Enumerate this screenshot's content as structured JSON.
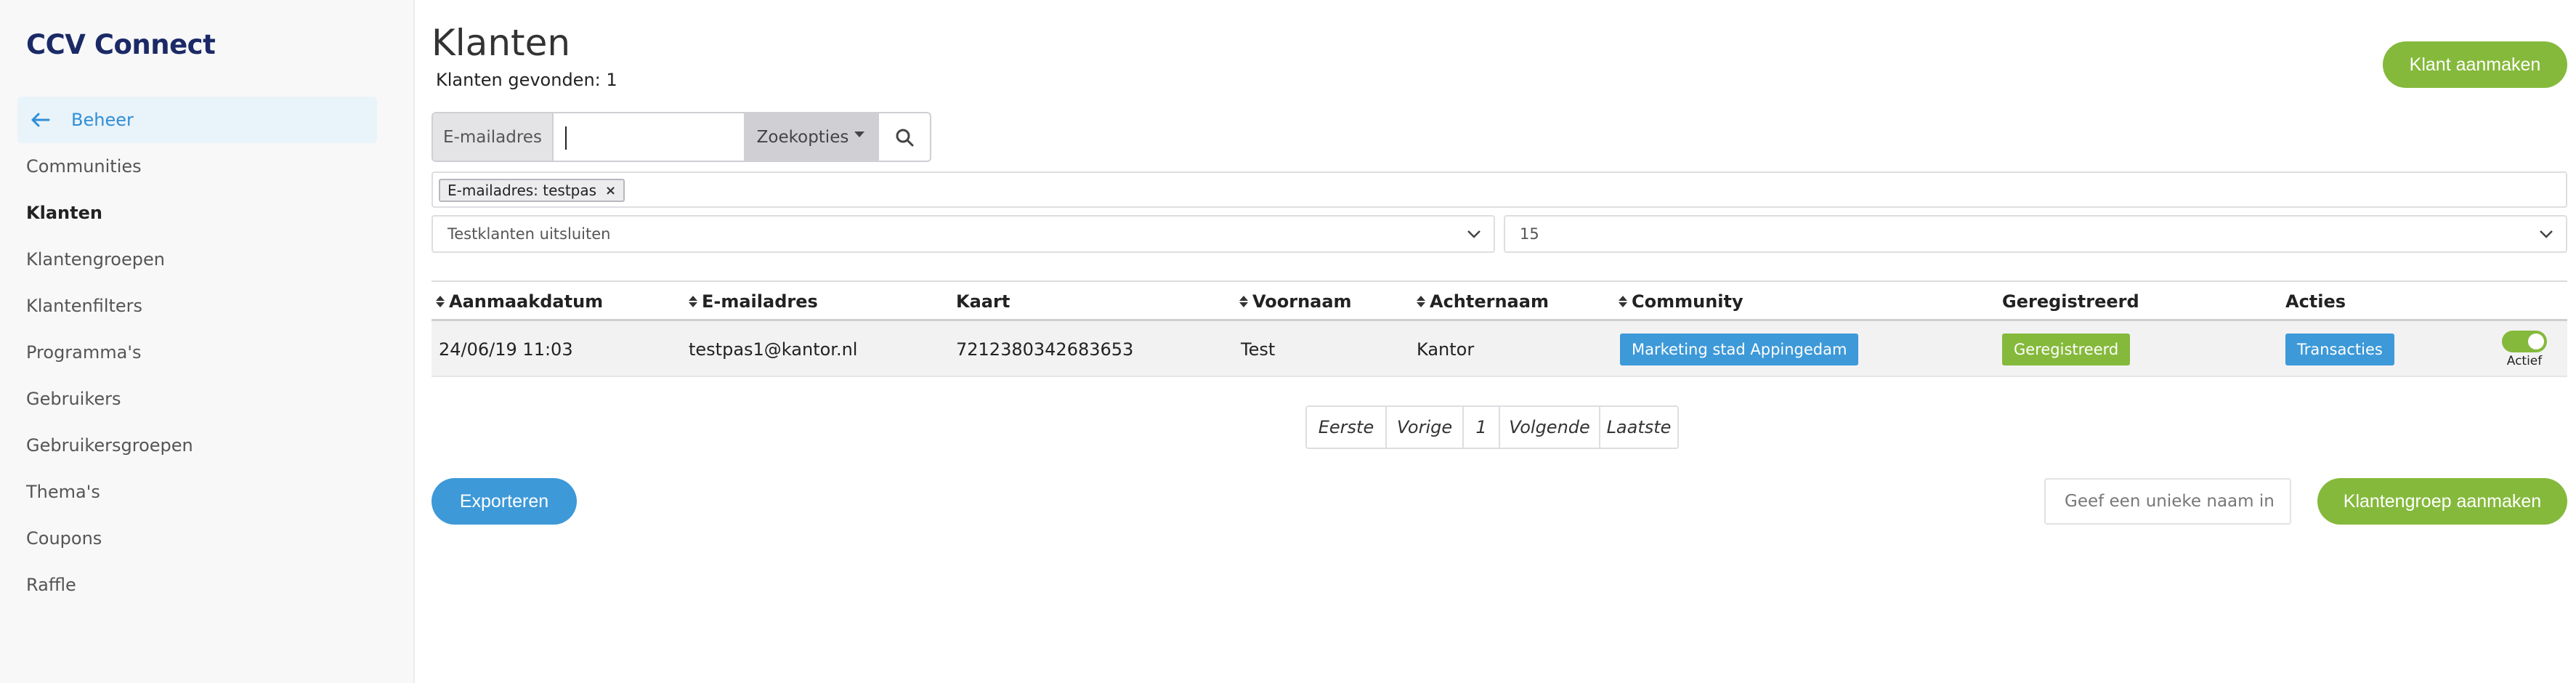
{
  "brand": "CCV Connect",
  "sidebar": {
    "back_label": "Beheer",
    "items": [
      {
        "label": "Communities",
        "active": false
      },
      {
        "label": "Klanten",
        "active": true
      },
      {
        "label": "Klantengroepen",
        "active": false
      },
      {
        "label": "Klantenfilters",
        "active": false
      },
      {
        "label": "Programma's",
        "active": false
      },
      {
        "label": "Gebruikers",
        "active": false
      },
      {
        "label": "Gebruikersgroepen",
        "active": false
      },
      {
        "label": "Thema's",
        "active": false
      },
      {
        "label": "Coupons",
        "active": false
      },
      {
        "label": "Raffle",
        "active": false
      }
    ]
  },
  "header": {
    "title": "Klanten",
    "found_text": "Klanten gevonden: 1",
    "create_button": "Klant aanmaken"
  },
  "search": {
    "field_label": "E-mailadres",
    "value": "",
    "options_label": "Zoekopties"
  },
  "filter_chip": "E-mailadres: testpas",
  "selects": {
    "testklanten": "Testklanten uitsluiten",
    "page_size": "15"
  },
  "table": {
    "headers": {
      "created": "Aanmaakdatum",
      "email": "E-mailadres",
      "card": "Kaart",
      "firstname": "Voornaam",
      "lastname": "Achternaam",
      "community": "Community",
      "registered": "Geregistreerd",
      "actions": "Acties"
    },
    "rows": [
      {
        "created": "24/06/19 11:03",
        "email": "testpas1@kantor.nl",
        "card": "7212380342683653",
        "firstname": "Test",
        "lastname": "Kantor",
        "community": "Marketing stad Appingedam",
        "registered": "Geregistreerd",
        "action": "Transacties",
        "status": "Actief"
      }
    ]
  },
  "pagination": {
    "first": "Eerste",
    "prev": "Vorige",
    "page": "1",
    "next": "Volgende",
    "last": "Laatste"
  },
  "footer": {
    "export_button": "Exporteren",
    "group_name_placeholder": "Geef een unieke naam in",
    "create_group_button": "Klantengroep aanmaken"
  },
  "colors": {
    "brand": "#1b2a66",
    "accent_blue": "#3d99d8",
    "accent_green": "#85b93b"
  }
}
